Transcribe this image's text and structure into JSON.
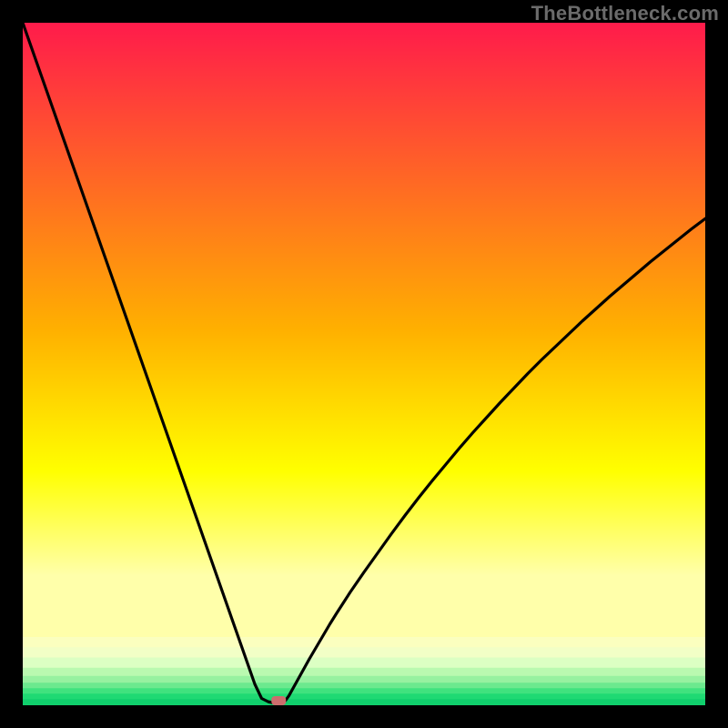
{
  "watermark": {
    "text": "TheBottleneck.com"
  },
  "chart_data": {
    "type": "line",
    "title": "",
    "xlabel": "",
    "ylabel": "",
    "xlim": [
      0,
      100
    ],
    "ylim": [
      0,
      100
    ],
    "x": [
      0,
      2,
      4,
      6,
      8,
      10,
      12,
      14,
      16,
      18,
      20,
      22,
      24,
      26,
      28,
      30,
      32,
      34,
      35,
      36,
      37,
      38,
      38.5,
      39,
      39.5,
      40,
      40.5,
      41,
      42,
      43,
      44,
      45,
      46,
      48,
      50,
      52,
      54,
      56,
      58,
      60,
      62,
      64,
      66,
      68,
      70,
      72,
      74,
      76,
      78,
      80,
      82,
      84,
      86,
      88,
      90,
      92,
      94,
      96,
      98,
      100
    ],
    "values": [
      100,
      94.3,
      88.6,
      82.9,
      77.2,
      71.5,
      65.8,
      60.1,
      54.4,
      48.7,
      43.0,
      37.3,
      31.6,
      25.9,
      20.2,
      14.5,
      8.8,
      3.1,
      1.0,
      0.5,
      0.3,
      0.3,
      0.7,
      1.4,
      2.3,
      3.2,
      4.1,
      5.0,
      6.8,
      8.5,
      10.2,
      11.9,
      13.5,
      16.6,
      19.5,
      22.3,
      25.1,
      27.8,
      30.4,
      32.9,
      35.3,
      37.7,
      40.0,
      42.2,
      44.4,
      46.5,
      48.6,
      50.6,
      52.5,
      54.4,
      56.3,
      58.1,
      59.9,
      61.6,
      63.3,
      65.0,
      66.6,
      68.2,
      69.8,
      71.3
    ],
    "marker": {
      "x": 37.5,
      "y": 0
    },
    "background": {
      "type": "vertical-gradient",
      "base_stops": [
        {
          "offset": 0.0,
          "color": "#ff1b4b"
        },
        {
          "offset": 0.5,
          "color": "#ffb000"
        },
        {
          "offset": 0.73,
          "color": "#ffff00"
        },
        {
          "offset": 0.83,
          "color": "#ffff66"
        },
        {
          "offset": 0.9,
          "color": "#ffffaa"
        }
      ],
      "bands": [
        {
          "from": 0.9,
          "to": 0.915,
          "color": "#fbffbf"
        },
        {
          "from": 0.915,
          "to": 0.93,
          "color": "#f2ffc6"
        },
        {
          "from": 0.93,
          "to": 0.945,
          "color": "#dcffc3"
        },
        {
          "from": 0.945,
          "to": 0.957,
          "color": "#baf9b0"
        },
        {
          "from": 0.957,
          "to": 0.967,
          "color": "#97f1a0"
        },
        {
          "from": 0.967,
          "to": 0.975,
          "color": "#6ce98e"
        },
        {
          "from": 0.975,
          "to": 0.983,
          "color": "#40e27e"
        },
        {
          "from": 0.983,
          "to": 0.991,
          "color": "#1fd973"
        },
        {
          "from": 0.991,
          "to": 1.0,
          "color": "#10cf6c"
        }
      ]
    }
  }
}
